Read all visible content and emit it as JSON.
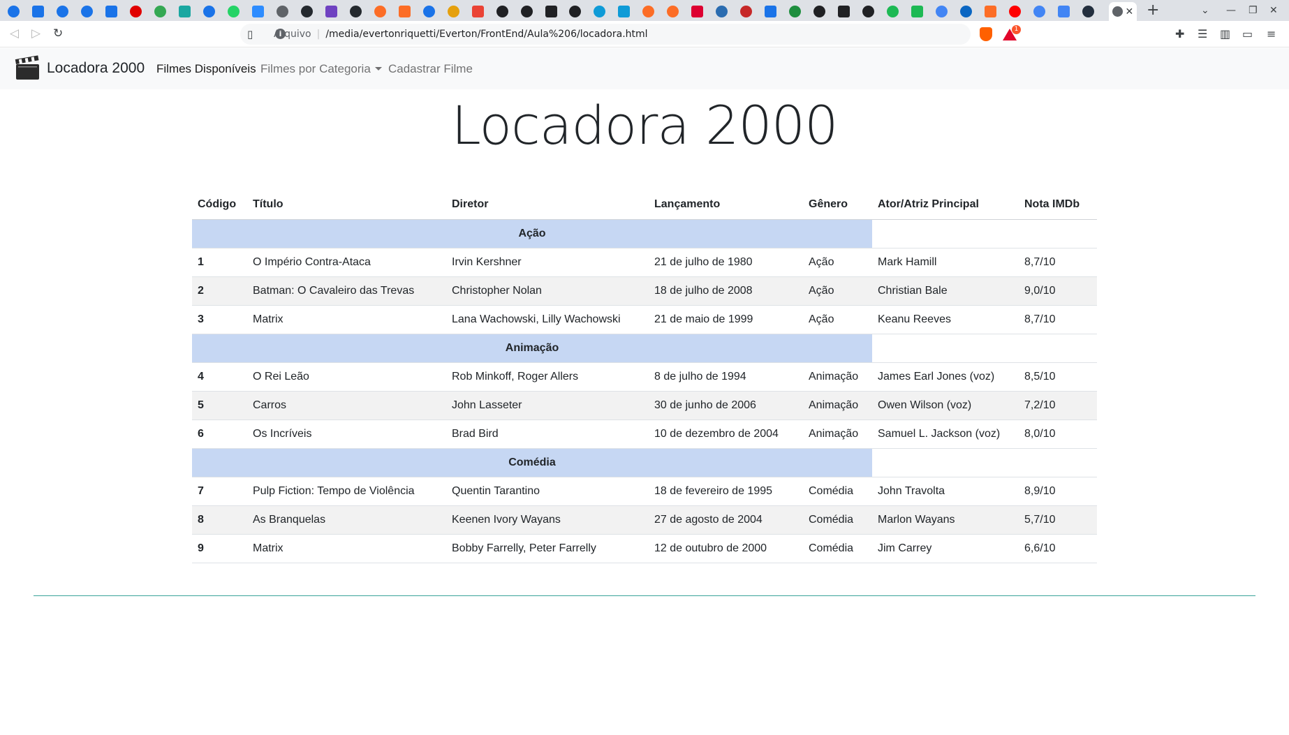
{
  "browser": {
    "url_scheme": "Arquivo",
    "url_path": "/media/evertonriquetti/Everton/FrontEnd/Aula%206/locadora.html",
    "rewards_count": "1",
    "tab_colors": [
      "#1a73e8",
      "#1a73e8",
      "#1a73e8",
      "#1a73e8",
      "#1a73e8",
      "#e00000",
      "#34a853",
      "#1aa7a1",
      "#1a73e8",
      "#25d366",
      "#2d8cff",
      "#5f6368",
      "#24292e",
      "#6f42c1",
      "#24292e",
      "#fc6d26",
      "#fc6d26",
      "#1a73e8",
      "#e5a00d",
      "#ea4335",
      "#202124",
      "#202124",
      "#202124",
      "#202124",
      "#0f9bd7",
      "#0f9bd7",
      "#fc6d26",
      "#fc6d26",
      "#dd0031",
      "#2b6cb0",
      "#c62828",
      "#1a73e8",
      "#1e8e3e",
      "#202124",
      "#202124",
      "#202124",
      "#1db954",
      "#1db954",
      "#4285f4",
      "#0a66c2",
      "#fc6d26",
      "#ff0000",
      "#4285f4",
      "#4285f4",
      "#232f3e"
    ]
  },
  "navbar": {
    "brand": "Locadora 2000",
    "links": [
      "Filmes Disponíveis",
      "Filmes por Categoria",
      "Cadastrar Filme"
    ]
  },
  "page": {
    "title": "Locadora 2000"
  },
  "table": {
    "headers": [
      "Código",
      "Título",
      "Diretor",
      "Lançamento",
      "Gênero",
      "Ator/Atriz Principal",
      "Nota IMDb"
    ],
    "groups": [
      {
        "category": "Ação",
        "rows": [
          [
            "1",
            "O Império Contra-Ataca",
            "Irvin Kershner",
            "21 de julho de 1980",
            "Ação",
            "Mark Hamill",
            "8,7/10"
          ],
          [
            "2",
            "Batman: O Cavaleiro das Trevas",
            "Christopher Nolan",
            "18 de julho de 2008",
            "Ação",
            "Christian Bale",
            "9,0/10"
          ],
          [
            "3",
            "Matrix",
            "Lana Wachowski, Lilly Wachowski",
            "21 de maio de 1999",
            "Ação",
            "Keanu Reeves",
            "8,7/10"
          ]
        ]
      },
      {
        "category": "Animação",
        "rows": [
          [
            "4",
            "O Rei Leão",
            "Rob Minkoff, Roger Allers",
            "8 de julho de 1994",
            "Animação",
            "James Earl Jones (voz)",
            "8,5/10"
          ],
          [
            "5",
            "Carros",
            "John Lasseter",
            "30 de junho de 2006",
            "Animação",
            "Owen Wilson (voz)",
            "7,2/10"
          ],
          [
            "6",
            "Os Incríveis",
            "Brad Bird",
            "10 de dezembro de 2004",
            "Animação",
            "Samuel L. Jackson (voz)",
            "8,0/10"
          ]
        ]
      },
      {
        "category": "Comédia",
        "rows": [
          [
            "7",
            "Pulp Fiction: Tempo de Violência",
            "Quentin Tarantino",
            "18 de fevereiro de 1995",
            "Comédia",
            "John Travolta",
            "8,9/10"
          ],
          [
            "8",
            "As Branquelas",
            "Keenen Ivory Wayans",
            "27 de agosto de 2004",
            "Comédia",
            "Marlon Wayans",
            "5,7/10"
          ],
          [
            "9",
            "Matrix",
            "Bobby Farrelly, Peter Farrelly",
            "12 de outubro de 2000",
            "Comédia",
            "Jim Carrey",
            "6,6/10"
          ]
        ]
      }
    ]
  },
  "colors": {
    "category_band": "#c6d7f3",
    "stripe": "#f2f2f2",
    "footer_rule": "#3aa39a",
    "navbar_bg": "#f8f9fa"
  }
}
